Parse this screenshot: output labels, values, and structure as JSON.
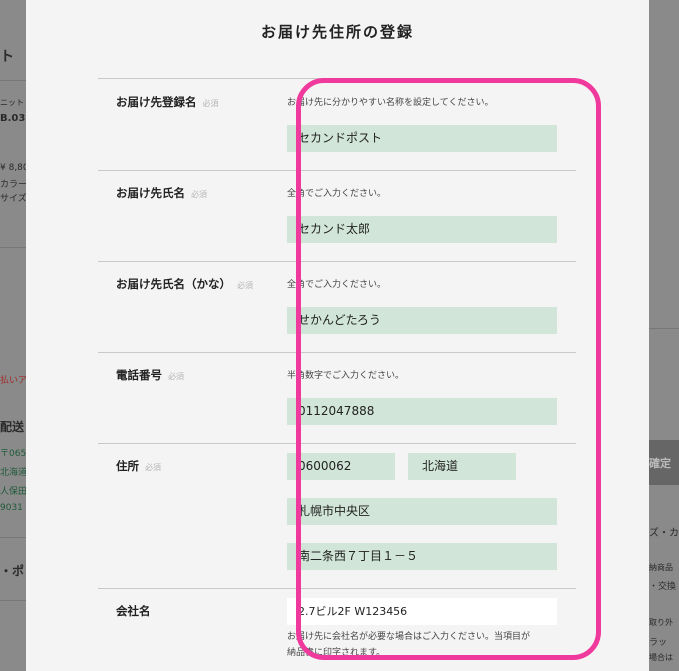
{
  "modal": {
    "title": "お届け先住所の登録"
  },
  "required_label": "必須",
  "rows": {
    "alias": {
      "label": "お届け先登録名",
      "hint": "お届け先に分かりやすい名称を設定してください。",
      "value": "セカンドポスト"
    },
    "name": {
      "label": "お届け先氏名",
      "hint": "全角でご入力ください。",
      "value": "セカンド太郎"
    },
    "kana": {
      "label": "お届け先氏名（かな）",
      "hint": "全角でご入力ください。",
      "value": "せかんどたろう"
    },
    "phone": {
      "label": "電話番号",
      "hint": "半角数字でご入力ください。",
      "value": "0112047888"
    },
    "address": {
      "label": "住所",
      "postal": "0600062",
      "prefecture": "北海道",
      "city": "札幌市中央区",
      "street": "南二条西７丁目１－５"
    },
    "company": {
      "label": "会社名",
      "value": "2.7ビル2F W123456",
      "hint_line1": "お届け先に会社名が必要な場合はご入力ください。当項目が",
      "hint_line2": "納品書に印字されます。"
    }
  },
  "background": {
    "left": [
      "ト",
      "ニット",
      "B.03",
      "¥ 8,800",
      "カラー：",
      "サイズ：",
      "払いア",
      "配送",
      "〒065-",
      "北海道",
      "人保田",
      "9031",
      "・ポ"
    ],
    "right": [
      "確定",
      "ズ・カ",
      "納商品",
      "・交換",
      "取り外",
      "ラッ",
      "場合は"
    ]
  },
  "colors": {
    "field": "#d1e6d8",
    "highlight": "#f0399c",
    "modal_bg": "#f4f4f4"
  }
}
